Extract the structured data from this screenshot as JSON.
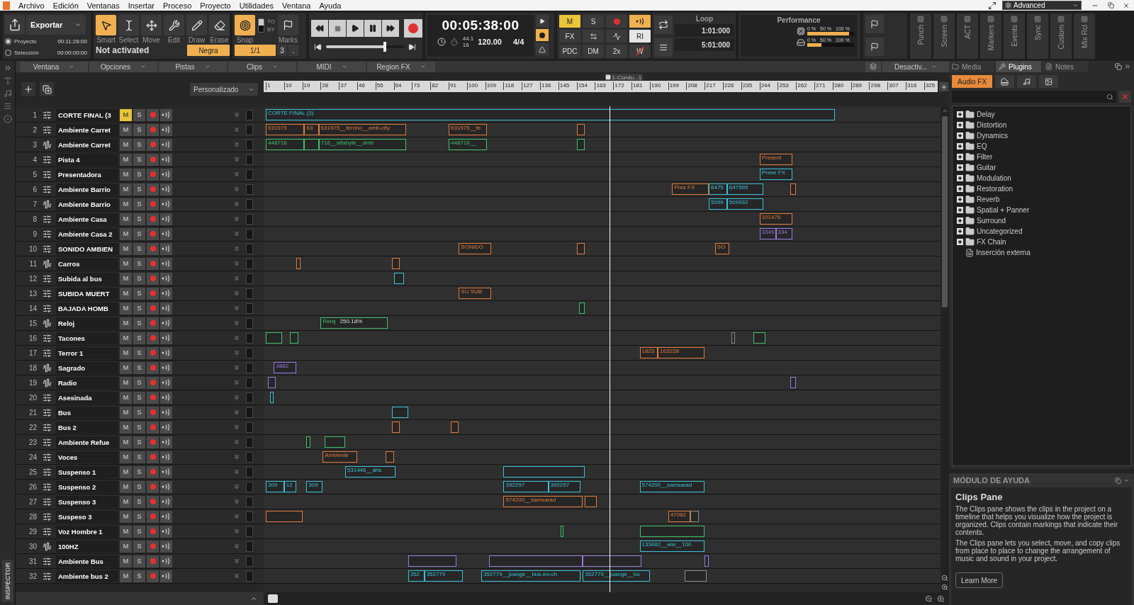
{
  "menu": [
    "Archivo",
    "Edición",
    "Ventanas",
    "Insertar",
    "Proceso",
    "Proyecto",
    "Utilidades",
    "Ventana",
    "Ayuda"
  ],
  "workspace": {
    "label": "Advanced"
  },
  "export": {
    "label": "Exportar",
    "options": [
      {
        "label": "Proyecto",
        "time": "00:11:26:00",
        "selected": true
      },
      {
        "label": "Selección",
        "time": "00:00:00:00",
        "selected": false
      }
    ]
  },
  "tools": {
    "items": [
      {
        "kind": "smart",
        "label": "Smart",
        "selected": true
      },
      {
        "kind": "select",
        "label": "Select",
        "selected": false
      },
      {
        "kind": "move",
        "label": "Move",
        "selected": false
      },
      {
        "kind": "edit",
        "label": "Edit",
        "selected": false
      },
      {
        "kind": "draw",
        "label": "Draw",
        "selected": false
      },
      {
        "kind": "erase",
        "label": "Erase",
        "selected": false
      }
    ],
    "status": "Not activated",
    "duration": "Negra"
  },
  "snap": {
    "label": "Snap",
    "on": true,
    "to": "TO",
    "by": "BY",
    "marks": "Marks",
    "value": "1/1",
    "count": "3",
    "dot": "."
  },
  "transport": {
    "level": 0.75
  },
  "time": {
    "display": "00:05:38:00",
    "sample_rate": "44.1",
    "bit_depth": "16",
    "tempo": "120.00",
    "meter": "4/4"
  },
  "mix": [
    {
      "kind": "text",
      "label": "M",
      "on": true,
      "color": "#e8c53a"
    },
    {
      "kind": "text",
      "label": "S",
      "on": false
    },
    {
      "kind": "record",
      "on": false
    },
    {
      "kind": "echo",
      "on": true,
      "color": "#f0b050"
    },
    {
      "kind": "text",
      "label": "FX",
      "on": false
    },
    {
      "kind": "stereo",
      "on": false
    },
    {
      "kind": "wave",
      "on": false
    },
    {
      "kind": "text",
      "label": "RI",
      "on": true,
      "color": "#e6e6e6"
    },
    {
      "kind": "text",
      "label": "PDC",
      "on": false
    },
    {
      "kind": "text",
      "label": "DM",
      "on": false
    },
    {
      "kind": "text",
      "label": "2x",
      "on": false
    },
    {
      "kind": "struck",
      "label": "W",
      "on": false
    }
  ],
  "loop": {
    "title": "Loop",
    "start": "1:01:000",
    "end": "5:01:000"
  },
  "performance": {
    "title": "Performance",
    "meters": [
      {
        "kind": "cpu",
        "scale": [
          "0 %",
          "50 %",
          "100 %"
        ],
        "level": 0.9
      },
      {
        "kind": "disk",
        "scale": [
          "0 %",
          "50 %",
          "100 %"
        ],
        "level": 0.3
      }
    ]
  },
  "modules": [
    "Punch",
    "Screen",
    "ACT",
    "Markers",
    "Events",
    "Sync",
    "Custom",
    "Mix Rcl"
  ],
  "clips_menu": [
    "Ventana",
    "Opciones",
    "Pistas",
    "Clips",
    "MIDI",
    "Region FX"
  ],
  "view_option": "Desactiv...",
  "track_view": {
    "preset": "Personalizado"
  },
  "ruler": {
    "ticks": [
      "1",
      "10",
      "19",
      "28",
      "37",
      "46",
      "55",
      "64",
      "73",
      "82",
      "91",
      "100",
      "109",
      "118",
      "127",
      "136",
      "145",
      "154",
      "163",
      "172",
      "181",
      "190",
      "199",
      "208",
      "217",
      "226",
      "235",
      "244",
      "253",
      "262",
      "271",
      "280",
      "289",
      "298",
      "307",
      "316",
      "325"
    ],
    "marker": "1-Condu...1"
  },
  "tracks": [
    {
      "number": "1",
      "kind": "instrument",
      "name": "CORTE FINAL (3",
      "mute": "M",
      "solo": "S",
      "muted": true,
      "clips": [
        {
          "color": "#3cc0d8",
          "label": "CORTE FINAL (3)"
        }
      ]
    },
    {
      "number": "2",
      "kind": "instrument",
      "name": "Ambiente Carret",
      "mute": "M",
      "solo": "S",
      "muted": false,
      "clips": [
        {
          "color": "#e07a3c",
          "label": "631975"
        },
        {
          "color": "#e07a3c",
          "label": "63"
        },
        {
          "color": "#e07a3c",
          "label": "631975__ferrino__amb-city"
        },
        {
          "color": "#e07a3c",
          "label": "631975__fe"
        },
        {
          "color": "#e07a3c"
        }
      ]
    },
    {
      "number": "3",
      "kind": "audio",
      "name": "Ambiente Carret",
      "mute": "M",
      "solo": "S",
      "muted": false,
      "clips": [
        {
          "color": "#3fbf6a",
          "label": "448716"
        },
        {
          "color": "#3fbf6a"
        },
        {
          "color": "#3fbf6a",
          "label": "716__alfabyte__amb"
        },
        {
          "color": "#3fbf6a",
          "label": "448716__"
        },
        {
          "color": "#3fbf6a"
        }
      ]
    },
    {
      "number": "4",
      "kind": "instrument",
      "name": "Pista 4",
      "mute": "M",
      "solo": "S",
      "muted": false,
      "clips": [
        {
          "color": "#e07a3c",
          "label": "Present"
        }
      ]
    },
    {
      "number": "5",
      "kind": "instrument",
      "name": "Presentadora",
      "mute": "M",
      "solo": "S",
      "muted": false,
      "clips": [
        {
          "color": "#3cc0d8",
          "label": "Prese FX"
        }
      ]
    },
    {
      "number": "6",
      "kind": "instrument",
      "name": "Ambiente Barrio",
      "mute": "M",
      "solo": "S",
      "muted": false,
      "clips": [
        {
          "color": "#e07a3c",
          "label": "Pres FX"
        },
        {
          "color": "#3cc0d8",
          "label": "6475"
        },
        {
          "color": "#3cc0d8",
          "label": "647595"
        },
        {
          "color": "#e07a3c"
        }
      ]
    },
    {
      "number": "7",
      "kind": "audio",
      "name": "Ambiente Barrio",
      "mute": "M",
      "solo": "S",
      "muted": false,
      "clips": [
        {
          "color": "#3cc0d8",
          "label": "5099"
        },
        {
          "color": "#3cc0d8",
          "label": "509932"
        }
      ]
    },
    {
      "number": "8",
      "kind": "instrument",
      "name": "Ambiente Casa",
      "mute": "M",
      "solo": "S",
      "muted": false,
      "clips": [
        {
          "color": "#e07a3c",
          "label": "101476"
        }
      ]
    },
    {
      "number": "9",
      "kind": "instrument",
      "name": "Ambiente Casa 2",
      "mute": "M",
      "solo": "S",
      "muted": false,
      "clips": [
        {
          "color": "#9a7ae0",
          "label": "3349"
        },
        {
          "color": "#9a7ae0",
          "label": "334"
        }
      ]
    },
    {
      "number": "10",
      "kind": "instrument",
      "name": "SONIDO AMBIEN",
      "mute": "M",
      "solo": "S",
      "muted": false,
      "clips": [
        {
          "color": "#e07a3c",
          "label": "SONIDO"
        },
        {
          "color": "#e07a3c"
        },
        {
          "color": "#e07a3c",
          "label": "SO"
        }
      ]
    },
    {
      "number": "11",
      "kind": "audio",
      "name": "Carros",
      "mute": "M",
      "solo": "S",
      "muted": false,
      "clips": [
        {
          "color": "#e07a3c"
        },
        {
          "color": "#e07a3c"
        }
      ]
    },
    {
      "number": "12",
      "kind": "instrument",
      "name": "Subida al bus",
      "mute": "M",
      "solo": "S",
      "muted": false,
      "clips": [
        {
          "color": "#3cc0d8"
        }
      ]
    },
    {
      "number": "13",
      "kind": "instrument",
      "name": "SUBIDA MUERT",
      "mute": "M",
      "solo": "S",
      "muted": false,
      "clips": [
        {
          "color": "#e07a3c",
          "label": "SU SUB"
        }
      ]
    },
    {
      "number": "14",
      "kind": "instrument",
      "name": "BAJADA HOMB",
      "mute": "M",
      "solo": "S",
      "muted": false,
      "clips": [
        {
          "color": "#3fbf6a"
        }
      ]
    },
    {
      "number": "15",
      "kind": "audio",
      "name": "Reloj",
      "mute": "M",
      "solo": "S",
      "muted": false,
      "clips": [
        {
          "color": "#3fbf6a",
          "label": "Reloj",
          "gain": "250.18%"
        }
      ]
    },
    {
      "number": "16",
      "kind": "instrument",
      "name": "Tacones",
      "mute": "M",
      "solo": "S",
      "muted": false,
      "clips": [
        {
          "color": "#3fbf6a"
        },
        {
          "color": "#3fbf6a"
        },
        {
          "color": "#8a8a8a"
        },
        {
          "color": "#3fbf6a"
        }
      ]
    },
    {
      "number": "17",
      "kind": "instrument",
      "name": "Terror 1",
      "mute": "M",
      "solo": "S",
      "muted": false,
      "clips": [
        {
          "color": "#e07a3c",
          "label": "1823"
        },
        {
          "color": "#e07a3c",
          "label": "163228"
        }
      ]
    },
    {
      "number": "18",
      "kind": "audio",
      "name": "Sagrado",
      "mute": "M",
      "solo": "S",
      "muted": false,
      "clips": [
        {
          "color": "#9a7ae0",
          "label": "3882"
        }
      ]
    },
    {
      "number": "19",
      "kind": "audio",
      "name": "Radio",
      "mute": "M",
      "solo": "S",
      "muted": false,
      "clips": [
        {
          "color": "#9a7ae0"
        },
        {
          "color": "#9a7ae0"
        }
      ]
    },
    {
      "number": "20",
      "kind": "instrument",
      "name": "Asesinada",
      "mute": "M",
      "solo": "S",
      "muted": false,
      "clips": [
        {
          "color": "#3cc0d8"
        }
      ]
    },
    {
      "number": "21",
      "kind": "instrument",
      "name": "Bus",
      "mute": "M",
      "solo": "S",
      "muted": false,
      "clips": [
        {
          "color": "#3cc0d8"
        }
      ]
    },
    {
      "number": "22",
      "kind": "instrument",
      "name": "Bus 2",
      "mute": "M",
      "solo": "S",
      "muted": false,
      "clips": [
        {
          "color": "#e07a3c"
        },
        {
          "color": "#e07a3c"
        }
      ]
    },
    {
      "number": "23",
      "kind": "instrument",
      "name": "Ambiente Refue",
      "mute": "M",
      "solo": "S",
      "muted": false,
      "clips": [
        {
          "color": "#3fbf6a"
        },
        {
          "color": "#3fbf6a"
        }
      ]
    },
    {
      "number": "24",
      "kind": "instrument",
      "name": "Voces",
      "mute": "M",
      "solo": "S",
      "muted": false,
      "clips": [
        {
          "color": "#e07a3c",
          "label": "Ambiente"
        },
        {
          "color": "#e07a3c"
        }
      ]
    },
    {
      "number": "25",
      "kind": "instrument",
      "name": "Suspenso 1",
      "mute": "M",
      "solo": "S",
      "muted": false,
      "clips": [
        {
          "color": "#3cc0d8",
          "label": "531446__ahs"
        },
        {
          "color": "#3cc0d8"
        }
      ]
    },
    {
      "number": "26",
      "kind": "instrument",
      "name": "Suspenso 2",
      "mute": "M",
      "solo": "S",
      "muted": false,
      "clips": [
        {
          "color": "#3cc0d8",
          "label": "309"
        },
        {
          "color": "#3cc0d8",
          "label": "12"
        },
        {
          "color": "#3cc0d8",
          "label": "309"
        },
        {
          "color": "#3cc0d8",
          "label": "392297"
        },
        {
          "color": "#3cc0d8",
          "label": "392297"
        },
        {
          "color": "#3cc0d8",
          "label": "574200__samsarad"
        }
      ]
    },
    {
      "number": "27",
      "kind": "instrument",
      "name": "Suspenso 3",
      "mute": "M",
      "solo": "S",
      "muted": false,
      "clips": [
        {
          "color": "#e07a3c",
          "label": "574200__samsarad"
        },
        {
          "color": "#e07a3c"
        }
      ]
    },
    {
      "number": "28",
      "kind": "instrument",
      "name": "Suspeso 3",
      "mute": "M",
      "solo": "S",
      "muted": false,
      "clips": [
        {
          "color": "#e07a3c"
        },
        {
          "color": "#e07a3c",
          "label": "47082"
        },
        {
          "color": "#8a8a8a"
        }
      ]
    },
    {
      "number": "29",
      "kind": "instrument",
      "name": "Voz Hombre 1",
      "mute": "M",
      "solo": "S",
      "muted": false,
      "clips": [
        {
          "color": "#3fbf6a"
        },
        {
          "color": "#3fbf6a"
        }
      ]
    },
    {
      "number": "30",
      "kind": "audio",
      "name": "100HZ",
      "mute": "M",
      "solo": "S",
      "muted": false,
      "clips": [
        {
          "color": "#3cc0d8",
          "label": "133482__wie__100"
        }
      ]
    },
    {
      "number": "31",
      "kind": "instrument",
      "name": "Ambiente Bus",
      "mute": "M",
      "solo": "S",
      "muted": false,
      "clips": [
        {
          "color": "#9a7ae0"
        },
        {
          "color": "#9a7ae0"
        },
        {
          "color": "#9a7ae0"
        },
        {
          "color": "#9a7ae0"
        }
      ]
    },
    {
      "number": "32",
      "kind": "instrument",
      "name": "Ambiente bus 2",
      "mute": "M",
      "solo": "S",
      "muted": false,
      "clips": [
        {
          "color": "#3cc0d8",
          "label": "352"
        },
        {
          "color": "#3cc0d8",
          "label": "352779"
        },
        {
          "color": "#3cc0d8",
          "label": "352779__joange__bus-en-ch"
        },
        {
          "color": "#3cc0d8",
          "label": "352779__joange__bu"
        },
        {
          "color": "#8a8a8a"
        }
      ]
    }
  ],
  "inspector": {
    "label": "INSPECTOR"
  },
  "right_panel": {
    "tabs": [
      {
        "label": "Media",
        "selected": false
      },
      {
        "label": "Plugins",
        "selected": true
      },
      {
        "label": "Notes",
        "selected": false
      }
    ],
    "plugin_types": [
      {
        "kind": "audio",
        "label": "Audio FX",
        "selected": true
      },
      {
        "kind": "synth",
        "selected": false
      },
      {
        "kind": "midi",
        "selected": false
      },
      {
        "kind": "region",
        "selected": false
      }
    ],
    "tree": [
      {
        "kind": "folder",
        "label": "Delay",
        "expanded": false
      },
      {
        "kind": "folder",
        "label": "Distortion",
        "expanded": false
      },
      {
        "kind": "folder",
        "label": "Dynamics",
        "expanded": false
      },
      {
        "kind": "folder",
        "label": "EQ",
        "expanded": false
      },
      {
        "kind": "folder",
        "label": "Filter",
        "expanded": false
      },
      {
        "kind": "folder",
        "label": "Guitar",
        "expanded": false
      },
      {
        "kind": "folder",
        "label": "Modulation",
        "expanded": false
      },
      {
        "kind": "folder",
        "label": "Restoration",
        "expanded": false
      },
      {
        "kind": "folder",
        "label": "Reverb",
        "expanded": false
      },
      {
        "kind": "folder",
        "label": "Spatial + Panner",
        "expanded": false
      },
      {
        "kind": "folder",
        "label": "Surround",
        "expanded": false
      },
      {
        "kind": "folder",
        "label": "Uncategorized",
        "expanded": false
      },
      {
        "kind": "folder",
        "label": "FX Chain",
        "expanded": false
      },
      {
        "kind": "plugin",
        "label": "Inserción externa"
      }
    ]
  },
  "help": {
    "title": "MÓDULO DE AYUDA",
    "heading": "Clips Pane",
    "paragraphs": [
      "The Clips pane shows the clips in the project on a timeline that helps you visualize how the project is organized. Clips contain markings that indicate their contents.",
      "The Clips pane lets you select, move, and copy clips from place to place to change the arrangement of music and sound in your project."
    ],
    "button": "Learn More"
  }
}
